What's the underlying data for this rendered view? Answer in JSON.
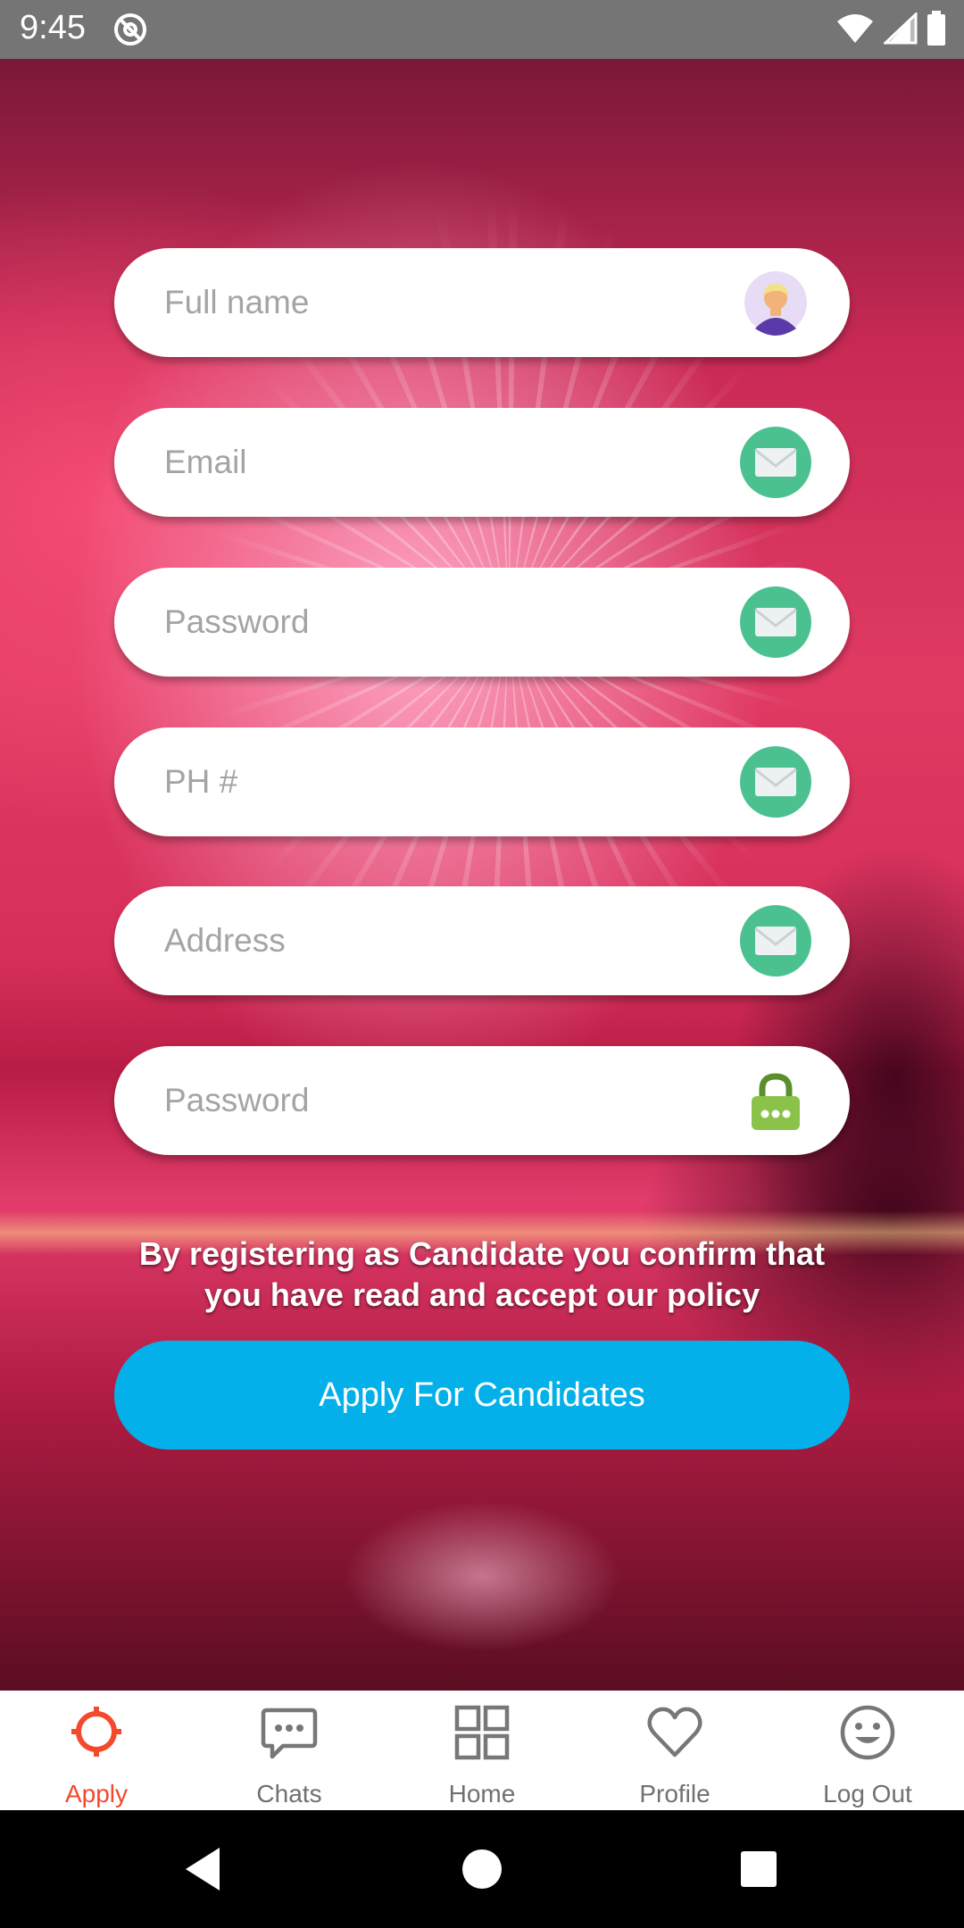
{
  "status_bar": {
    "time": "9:45"
  },
  "form": {
    "fields": [
      {
        "placeholder": "Full name",
        "icon": "avatar-icon"
      },
      {
        "placeholder": "Email",
        "icon": "mail-icon"
      },
      {
        "placeholder": "Password",
        "icon": "mail-icon"
      },
      {
        "placeholder": "PH #",
        "icon": "mail-icon"
      },
      {
        "placeholder": "Address",
        "icon": "mail-icon"
      },
      {
        "placeholder": "Password",
        "icon": "lock-icon"
      }
    ],
    "policy_text": "By registering as Candidate you confirm that you have read and accept our policy",
    "submit_label": "Apply For Candidates"
  },
  "bottom_nav": {
    "items": [
      {
        "label": "Apply",
        "icon": "crosshair-icon",
        "active": true
      },
      {
        "label": "Chats",
        "icon": "chat-icon",
        "active": false
      },
      {
        "label": "Home",
        "icon": "grid-icon",
        "active": false
      },
      {
        "label": "Profile",
        "icon": "heart-icon",
        "active": false
      },
      {
        "label": "Log Out",
        "icon": "smiley-icon",
        "active": false
      }
    ]
  },
  "colors": {
    "accent": "#03b0ea",
    "active_nav": "#f4492c",
    "mail_icon_bg": "#4cc190",
    "lock_icon": "#8bc34a"
  }
}
